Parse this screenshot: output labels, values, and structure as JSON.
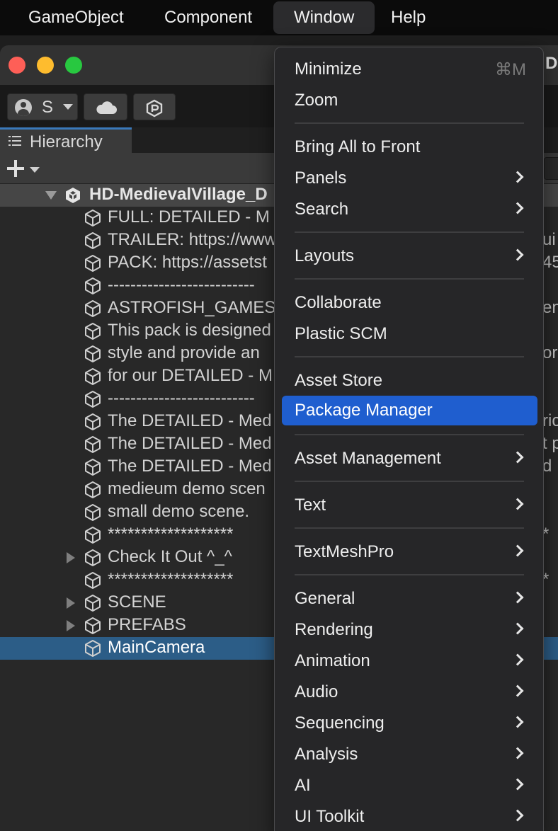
{
  "menubar": {
    "items": [
      {
        "label": "GameObject"
      },
      {
        "label": "Component"
      },
      {
        "label": "Window"
      },
      {
        "label": "Help"
      }
    ]
  },
  "window": {
    "title_fragment": "D",
    "account_initial": "S"
  },
  "hierarchy": {
    "tab_label": "Hierarchy",
    "scene_name": "HD-MedievalVillage_D",
    "scene_right_fragment": "",
    "rows": [
      {
        "label": "FULL: DETAILED - M",
        "right": ""
      },
      {
        "label": "TRAILER: https://www",
        "right": "ui"
      },
      {
        "label": "PACK: https://assetst",
        "right": "45"
      },
      {
        "label": "--------------------------",
        "right": ""
      },
      {
        "label": "ASTROFISH_GAMES",
        "right": "en"
      },
      {
        "label": "This pack is designed",
        "right": ""
      },
      {
        "label": "style and provide an",
        "right": "or"
      },
      {
        "label": "for our DETAILED - M",
        "right": ""
      },
      {
        "label": "--------------------------",
        "right": ""
      },
      {
        "label": "The DETAILED - Med",
        "right": "ric"
      },
      {
        "label": "The DETAILED - Med",
        "right": "t p"
      },
      {
        "label": "The DETAILED - Med",
        "right": "d"
      },
      {
        "label": " medieum demo scen",
        "right": ""
      },
      {
        "label": " small demo scene.",
        "right": ""
      },
      {
        "label": "*******************",
        "right": "*"
      },
      {
        "label": "Check It Out ^_^",
        "right": ""
      },
      {
        "label": "*******************",
        "right": "*"
      },
      {
        "label": "SCENE",
        "right": ""
      },
      {
        "label": "PREFABS",
        "right": ""
      },
      {
        "label": "MainCamera",
        "right": ""
      }
    ]
  },
  "menu": {
    "minimize_label": "Minimize",
    "minimize_shortcut": "⌘M",
    "zoom_label": "Zoom",
    "bring_all_label": "Bring All to Front",
    "panels_label": "Panels",
    "search_label": "Search",
    "layouts_label": "Layouts",
    "collaborate_label": "Collaborate",
    "plastic_label": "Plastic SCM",
    "asset_store_label": "Asset Store",
    "package_manager_label": "Package Manager",
    "asset_management_label": "Asset Management",
    "text_label": "Text",
    "textmeshpro_label": "TextMeshPro",
    "general_label": "General",
    "rendering_label": "Rendering",
    "animation_label": "Animation",
    "audio_label": "Audio",
    "sequencing_label": "Sequencing",
    "analysis_label": "Analysis",
    "ai_label": "AI",
    "ui_toolkit_label": "UI Toolkit"
  }
}
